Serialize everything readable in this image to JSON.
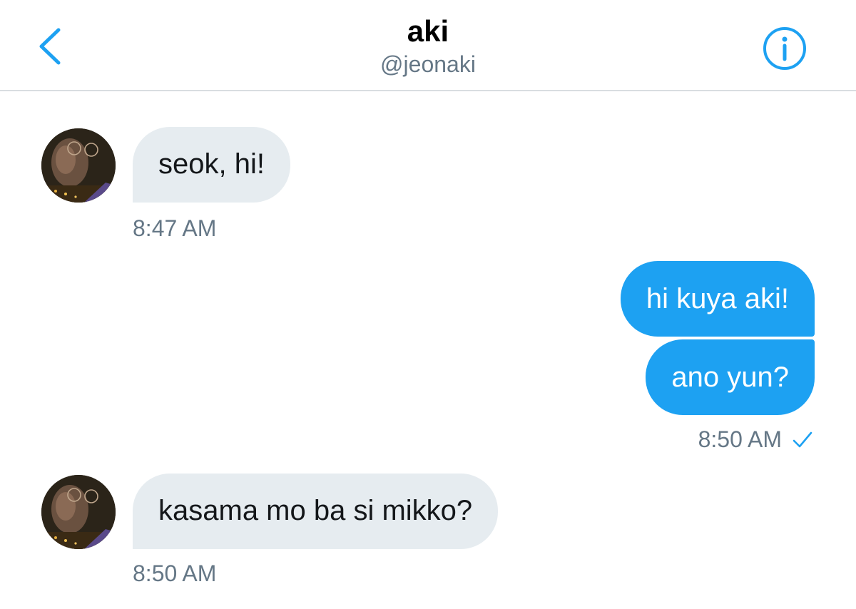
{
  "header": {
    "title": "aki",
    "handle": "@jeonaki",
    "back_icon": "chevron-left-icon",
    "info_icon": "info-circle-icon",
    "accent_color": "#1da1f2"
  },
  "messages": [
    {
      "direction": "incoming",
      "text": "seok, hi!",
      "time": "8:47 AM"
    },
    {
      "direction": "outgoing",
      "text": "hi kuya aki!"
    },
    {
      "direction": "outgoing",
      "text": "ano yun?",
      "time": "8:50 AM",
      "status_icon": "checkmark-icon"
    },
    {
      "direction": "incoming",
      "text": "kasama mo ba si mikko?",
      "time": "8:50 AM"
    }
  ],
  "colors": {
    "incoming_bubble": "#e6ecf0",
    "outgoing_bubble": "#1da1f2",
    "timestamp": "#657786"
  }
}
